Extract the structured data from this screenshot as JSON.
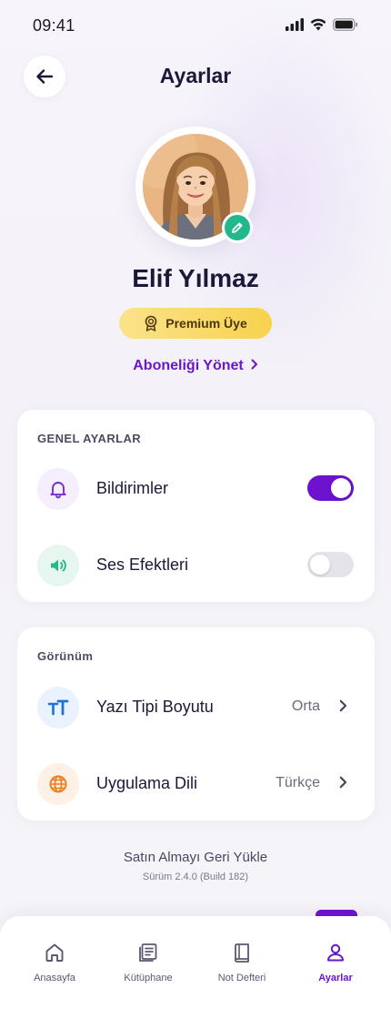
{
  "status_bar": {
    "time": "09:41"
  },
  "header": {
    "title": "Ayarlar"
  },
  "profile": {
    "name": "Elif Yılmaz",
    "badge": "Premium Üye",
    "manage_link": "Aboneliği Yönet"
  },
  "general": {
    "section_label": "GENEL AYARLAR",
    "items": [
      {
        "label": "Bildirimler",
        "icon": "bell-icon",
        "toggle_on": true
      },
      {
        "label": "Ses Efektleri",
        "icon": "speaker-icon",
        "toggle_on": false
      }
    ]
  },
  "view": {
    "section_label": "Görünüm",
    "items": [
      {
        "label": "Yazı Tipi Boyutu",
        "value": "Orta",
        "icon": "text-size-icon"
      },
      {
        "label": "Uygulama Dili",
        "value": "Türkçe",
        "icon": "globe-icon"
      }
    ]
  },
  "footer": {
    "restore": "Satın Almayı Geri Yükle",
    "version": "Sürüm 2.4.0 (Build 182)"
  },
  "nav": {
    "items": [
      {
        "label": "Anasayfa",
        "icon": "home-icon",
        "active": false
      },
      {
        "label": "Kütüphane",
        "icon": "library-icon",
        "active": false
      },
      {
        "label": "Not Defteri",
        "icon": "notebook-icon",
        "active": false
      },
      {
        "label": "Ayarlar",
        "icon": "profile-icon",
        "active": true
      }
    ]
  },
  "colors": {
    "accent": "#6d12cf",
    "link": "#6a16c9",
    "success": "#22b98a",
    "premium": "#f8d24e",
    "background": "#f5f4f8"
  }
}
